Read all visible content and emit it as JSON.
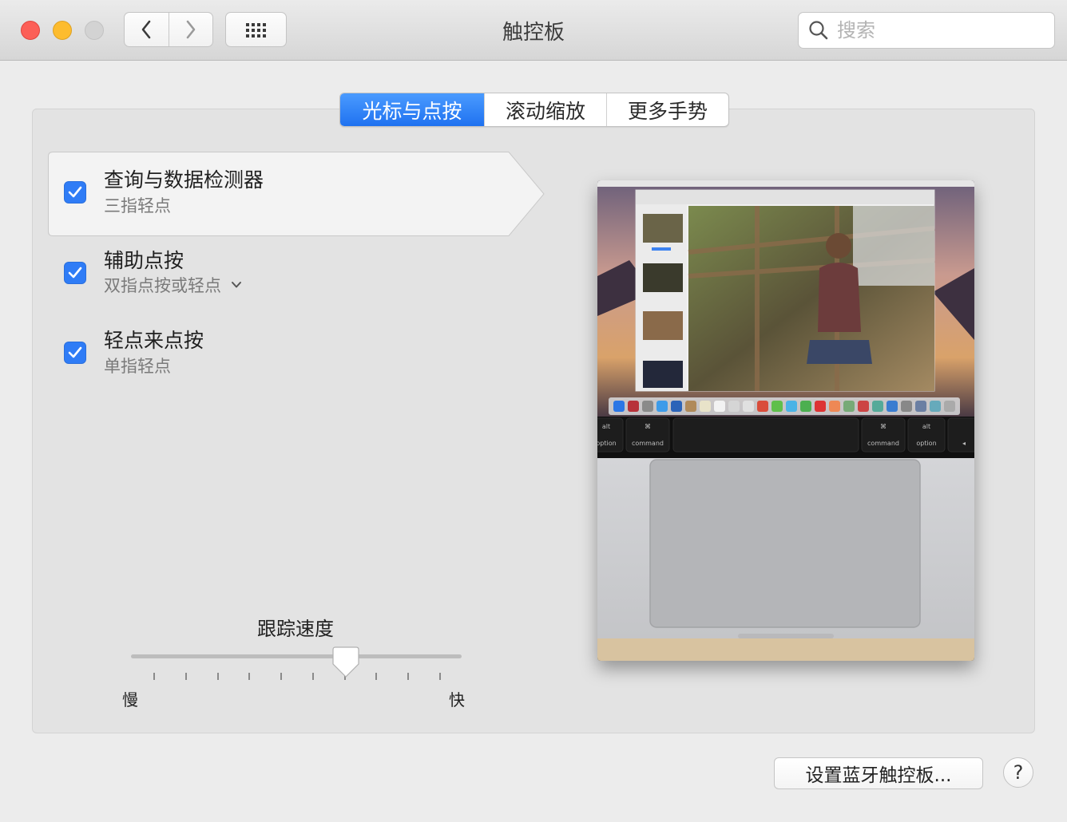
{
  "window": {
    "title": "触控板"
  },
  "search": {
    "placeholder": "搜索",
    "value": ""
  },
  "toolbar": {
    "back_icon": "chevron-left-icon",
    "forward_icon": "chevron-right-icon",
    "grid_icon": "grid-icon"
  },
  "tabs": [
    {
      "label": "光标与点按",
      "active": true
    },
    {
      "label": "滚动缩放",
      "active": false
    },
    {
      "label": "更多手势",
      "active": false
    }
  ],
  "options": [
    {
      "title": "查询与数据检测器",
      "subtitle": "三指轻点",
      "checked": true,
      "selected": true,
      "has_dropdown": false
    },
    {
      "title": "辅助点按",
      "subtitle": "双指点按或轻点",
      "checked": true,
      "selected": false,
      "has_dropdown": true
    },
    {
      "title": "轻点来点按",
      "subtitle": "单指轻点",
      "checked": true,
      "selected": false,
      "has_dropdown": false
    }
  ],
  "tracking_speed": {
    "label": "跟踪速度",
    "min_label": "慢",
    "max_label": "快",
    "value_fraction": 0.65,
    "tick_count": 10
  },
  "preview": {
    "keyboard_keys": [
      "alt",
      "option",
      "⌘",
      "command",
      "⌘",
      "command",
      "alt",
      "option",
      "◂"
    ]
  },
  "footer": {
    "bluetooth_button": "设置蓝牙触控板...",
    "help_button": "?"
  },
  "colors": {
    "accent": "#2f7cf6",
    "close": "#fc5f57",
    "minimize": "#fdbc2e",
    "zoom_disabled": "#d3d3d3"
  }
}
